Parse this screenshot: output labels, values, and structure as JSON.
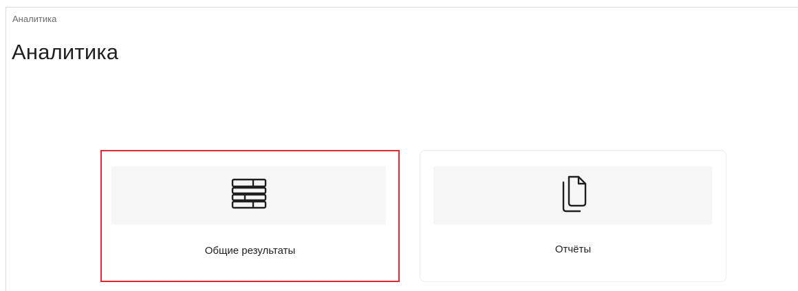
{
  "breadcrumb": "Аналитика",
  "page_title": "Аналитика",
  "cards": [
    {
      "label": "Общие результаты",
      "icon": "table-rows-icon",
      "selected": true
    },
    {
      "label": "Отчёты",
      "icon": "documents-copy-icon",
      "selected": false
    }
  ],
  "colors": {
    "selection_border": "#e3262f",
    "icon_area_bg": "#f6f6f6",
    "text": "#1f1f1f"
  }
}
